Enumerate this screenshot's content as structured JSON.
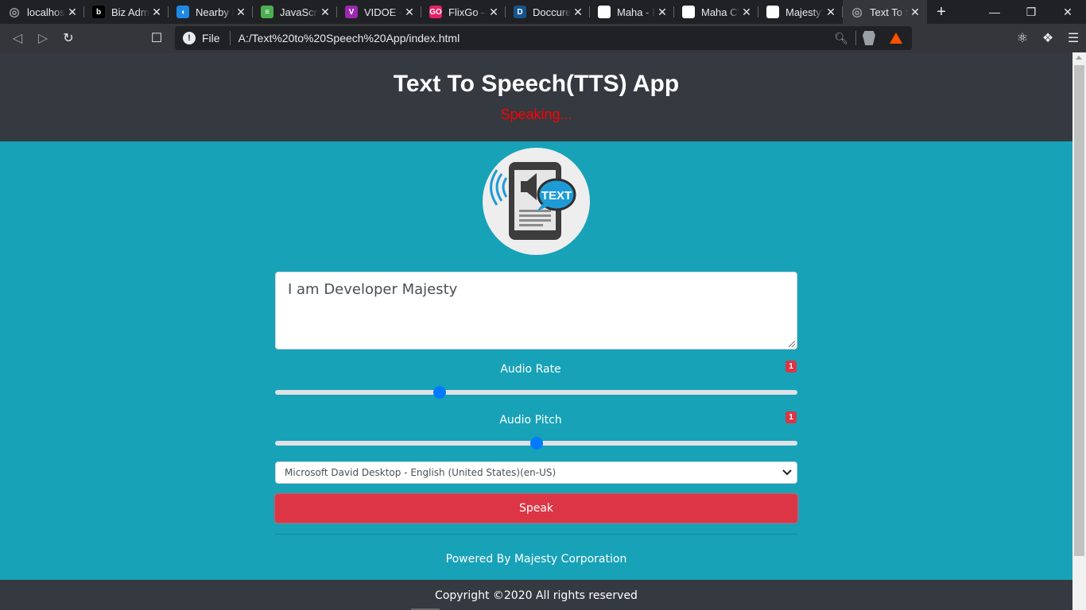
{
  "browser": {
    "tabs": [
      {
        "title": "localhost",
        "favicon": "globe-icon",
        "fav_color": "#5f6368",
        "active": false
      },
      {
        "title": "Biz Admin",
        "favicon": "b-logo-icon",
        "fav_color": "#000000",
        "active": false
      },
      {
        "title": "Nearby Places",
        "favicon": "drop-icon",
        "fav_color": "#1e88e5",
        "active": false
      },
      {
        "title": "JavaScript",
        "favicon": "w3-icon",
        "fav_color": "#4caf50",
        "active": false
      },
      {
        "title": "VIDOE - Video",
        "favicon": "v-logo-icon",
        "fav_color": "#9c27b0",
        "active": false
      },
      {
        "title": "FlixGo – Online",
        "favicon": "go-logo-icon",
        "fav_color": "#e91e63",
        "active": false
      },
      {
        "title": "Doccure",
        "favicon": "d-logo-icon",
        "fav_color": "#15558d",
        "active": false
      },
      {
        "title": "Maha - Personal",
        "favicon": "blank-page-icon",
        "fav_color": "#ffffff",
        "active": false
      },
      {
        "title": "Maha CV",
        "favicon": "blank-page-icon",
        "fav_color": "#ffffff",
        "active": false
      },
      {
        "title": "Majesty's",
        "favicon": "blank-page-icon",
        "fav_color": "#ffffff",
        "active": false
      },
      {
        "title": "Text To Speech",
        "favicon": "globe-icon",
        "fav_color": "#5f6368",
        "active": true
      }
    ],
    "address": {
      "scheme_label": "File",
      "url": "A:/Text%20to%20Speech%20App/index.html"
    }
  },
  "app": {
    "title": "Text To Speech(TTS) App",
    "status": "Speaking...",
    "logo_text": "TEXT",
    "textarea_value": "I am Developer Majesty",
    "rate": {
      "label": "Audio Rate",
      "badge": "1",
      "value": 1,
      "min": 0.1,
      "max": 3
    },
    "pitch": {
      "label": "Audio Pitch",
      "badge": "1",
      "value": 1,
      "min": 0,
      "max": 2
    },
    "voice_selected": "Microsoft David Desktop - English (United States)(en-US)",
    "speak_label": "Speak",
    "powered_by": "Powered By Majesty Corporation",
    "copyright": "Copyright ©2020 All rights reserved"
  },
  "colors": {
    "header_bg": "#343a40",
    "body_bg": "#17a2b8",
    "status": "#ff0000",
    "button": "#dc3545",
    "slider_thumb": "#007bff"
  }
}
